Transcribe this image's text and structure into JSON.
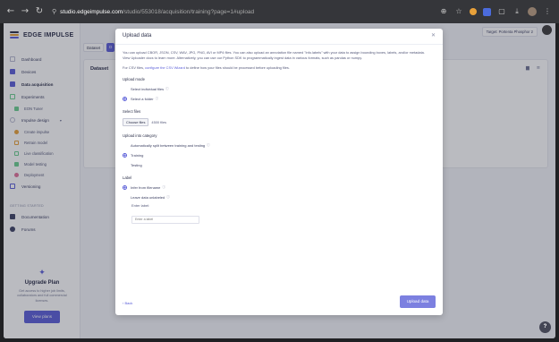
{
  "browser": {
    "url_host": "studio.edgeimpulse.com",
    "url_path": "/studio/553018/acquisition/training?page=1#upload",
    "icons": [
      "back-icon",
      "forward-icon",
      "reload-icon",
      "site-info-icon",
      "zoom-icon",
      "star-icon",
      "extensions-icon",
      "menu-icon"
    ]
  },
  "sidebar": {
    "logo_text": "EDGE IMPULSE",
    "items": [
      {
        "label": "Dashboard",
        "icon": "dashboard-icon",
        "color": "#b7b9d0"
      },
      {
        "label": "Devices",
        "icon": "devices-icon",
        "color": "#5a5ed8"
      },
      {
        "label": "Data acquisition",
        "icon": "database-icon",
        "color": "#5a5ed8"
      },
      {
        "label": "Experiments",
        "icon": "experiments-icon",
        "color": "#6bcf8f"
      },
      {
        "label": "EON Tuner",
        "icon": "tuner-icon",
        "color": "#6bcf8f"
      },
      {
        "label": "Impulse design",
        "icon": "impulse-icon",
        "color": "#b7b9d0"
      },
      {
        "label": "Create impulse",
        "icon": "create-impulse-icon",
        "color": "#e8a13a"
      },
      {
        "label": "Retrain model",
        "icon": "retrain-icon",
        "color": "#e8a13a"
      },
      {
        "label": "Live classification",
        "icon": "live-icon",
        "color": "#6bcf8f"
      },
      {
        "label": "Model testing",
        "icon": "testing-icon",
        "color": "#6bcf8f"
      },
      {
        "label": "Deployment",
        "icon": "deployment-icon",
        "color": "#e0709a"
      },
      {
        "label": "Versioning",
        "icon": "versioning-icon",
        "color": "#5a5ed8"
      }
    ],
    "section": "GETTING STARTED",
    "getting_started": [
      {
        "label": "Documentation",
        "icon": "book-icon",
        "color": "#3d4163"
      },
      {
        "label": "Forums",
        "icon": "forum-icon",
        "color": "#3d4163"
      }
    ],
    "upgrade": {
      "title": "Upgrade Plan",
      "text": "Get access to higher job limits, collaborators and full commercial licenses.",
      "button": "View plans"
    }
  },
  "main": {
    "project": "Target: Portenta Phosphor 2",
    "tabs": [
      "Dataset",
      "D"
    ],
    "dataset_title": "Dataset"
  },
  "modal": {
    "title": "Upload data",
    "intro": "You can upload CBOR, JSON, CSV, WAV, JPG, PNG, AVI or MP4 files. You can also upload an annotation file named \"info.labels\" with your data to assign bounding boxes, labels, and/or metadata. View Uploader docs to learn more. Alternatively, you can use our Python SDK to programmatically ingest data in various formats, such as pandas or numpy.",
    "csv_prefix": "For CSV files,",
    "csv_link": "configure the CSV Wizard",
    "csv_suffix": "to define how your files should be processed before uploading files.",
    "upload_mode_label": "Upload mode",
    "upload_mode_options": [
      "Select individual files",
      "Select a folder"
    ],
    "select_files_label": "Select files",
    "choose_button": "Choose files",
    "files_chosen": "4500 files",
    "category_label": "Upload into category",
    "category_options": [
      "Automatically split between training and testing",
      "Training",
      "Testing"
    ],
    "label_label": "Label",
    "label_options": [
      "Infer from filename",
      "Leave data unlabeled",
      "Enter label:"
    ],
    "label_placeholder": "Enter a label",
    "back": "‹ Back",
    "upload_button": "Upload data"
  }
}
